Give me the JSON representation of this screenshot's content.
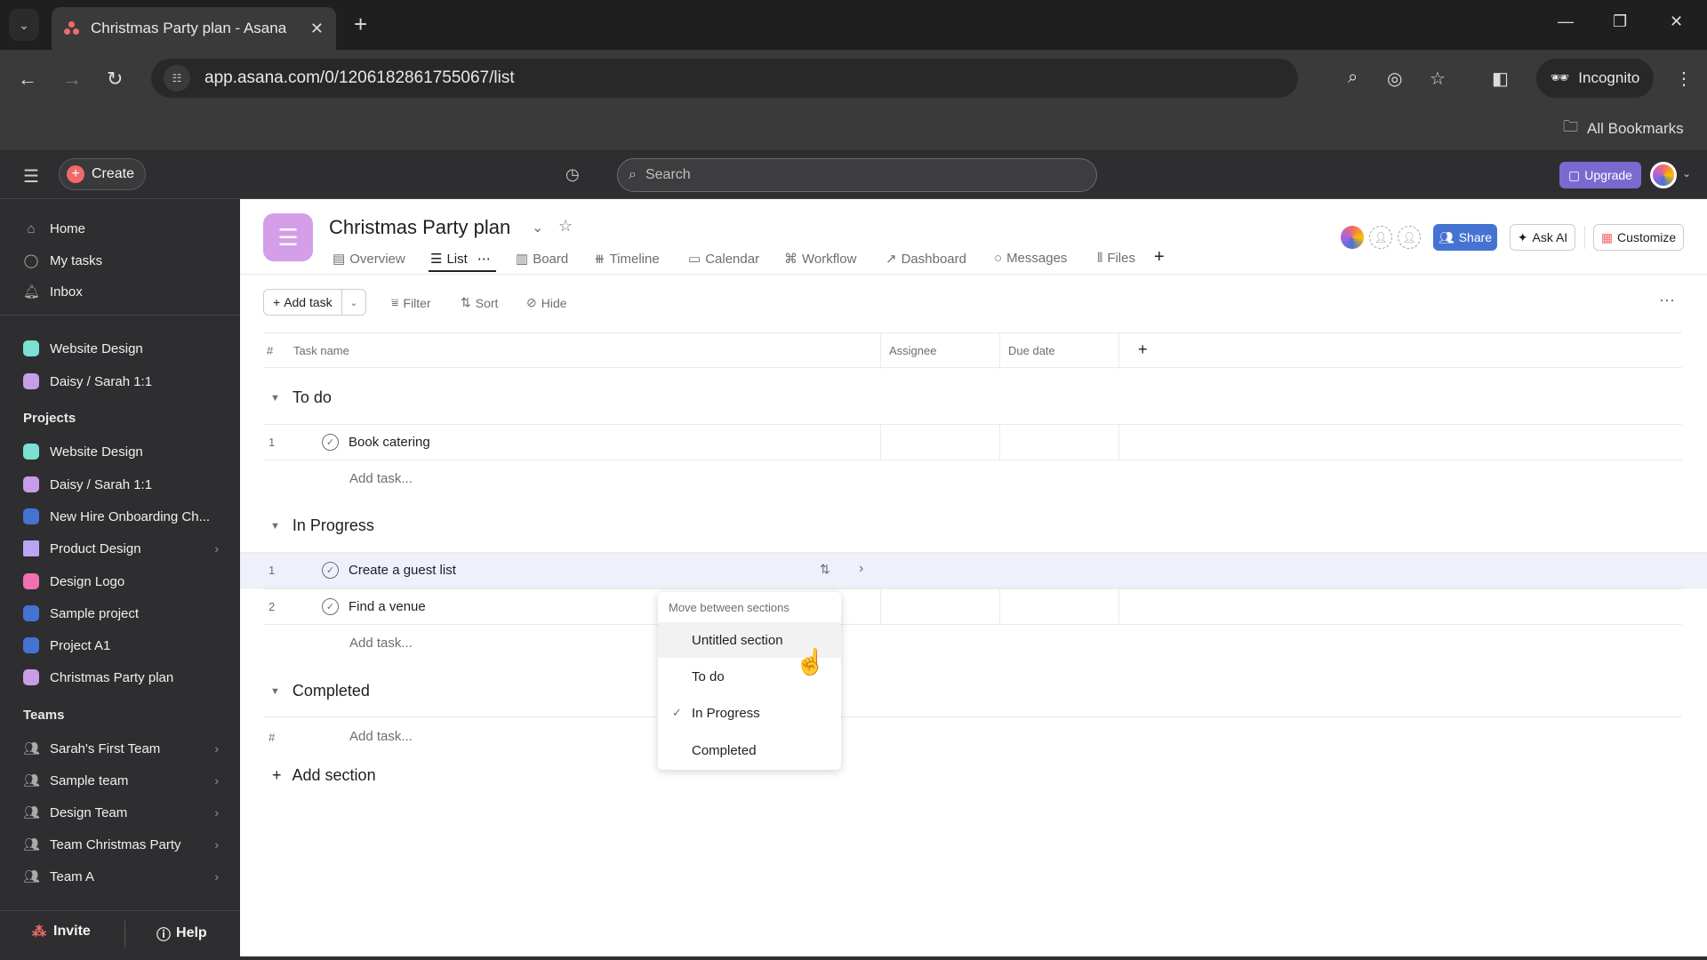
{
  "browser": {
    "tab_title": "Christmas Party plan - Asana",
    "url": "app.asana.com/0/1206182861755067/list",
    "incognito_label": "Incognito",
    "bookmarks_label": "All Bookmarks"
  },
  "topbar": {
    "create_label": "Create",
    "search_placeholder": "Search",
    "upgrade_label": "Upgrade"
  },
  "sidebar": {
    "nav": [
      {
        "label": "Home",
        "icon": "home-icon"
      },
      {
        "label": "My tasks",
        "icon": "check-circle-icon"
      },
      {
        "label": "Inbox",
        "icon": "bell-icon"
      }
    ],
    "favorites": [
      {
        "label": "Website Design",
        "color": "#7ce0d3"
      },
      {
        "label": "Daisy / Sarah 1:1",
        "color": "#c79de8"
      }
    ],
    "projects_header": "Projects",
    "projects": [
      {
        "label": "Website Design",
        "color": "#7ce0d3"
      },
      {
        "label": "Daisy / Sarah 1:1",
        "color": "#c79de8"
      },
      {
        "label": "New Hire Onboarding Ch...",
        "color": "#4573d2"
      },
      {
        "label": "Product Design",
        "color": "#b8a6f2",
        "folder": true
      },
      {
        "label": "Design Logo",
        "color": "#f26fb2"
      },
      {
        "label": "Sample project",
        "color": "#4573d2"
      },
      {
        "label": "Project A1",
        "color": "#4573d2"
      },
      {
        "label": "Christmas Party plan",
        "color": "#c79de8"
      }
    ],
    "teams_header": "Teams",
    "teams": [
      {
        "label": "Sarah's First Team"
      },
      {
        "label": "Sample team"
      },
      {
        "label": "Design Team"
      },
      {
        "label": "Team Christmas Party"
      },
      {
        "label": "Team A"
      }
    ],
    "invite_label": "Invite",
    "help_label": "Help"
  },
  "project": {
    "title": "Christmas Party plan",
    "color": "#d59ee8",
    "tabs": [
      {
        "label": "Overview"
      },
      {
        "label": "List"
      },
      {
        "label": "Board"
      },
      {
        "label": "Timeline"
      },
      {
        "label": "Calendar"
      },
      {
        "label": "Workflow"
      },
      {
        "label": "Dashboard"
      },
      {
        "label": "Messages"
      },
      {
        "label": "Files"
      }
    ],
    "active_tab": "List",
    "share_label": "Share",
    "askai_label": "Ask AI",
    "customize_label": "Customize"
  },
  "toolbar": {
    "add_task_label": "Add task",
    "filter_label": "Filter",
    "sort_label": "Sort",
    "hide_label": "Hide"
  },
  "table": {
    "columns": {
      "num": "#",
      "task": "Task name",
      "assignee": "Assignee",
      "due": "Due date"
    },
    "add_task_placeholder": "Add task...",
    "add_section_label": "Add section",
    "sections": [
      {
        "name": "To do",
        "tasks": [
          {
            "num": "1",
            "name": "Book catering"
          }
        ]
      },
      {
        "name": "In Progress",
        "tasks": [
          {
            "num": "1",
            "name": "Create a guest list"
          },
          {
            "num": "2",
            "name": "Find a venue"
          }
        ]
      },
      {
        "name": "Completed",
        "tasks": [],
        "placeholder_num": "#"
      }
    ]
  },
  "menu": {
    "title": "Move between sections",
    "items": [
      {
        "label": "Untitled section",
        "hover": true
      },
      {
        "label": "To do"
      },
      {
        "label": "In Progress",
        "checked": true
      },
      {
        "label": "Completed"
      }
    ]
  }
}
